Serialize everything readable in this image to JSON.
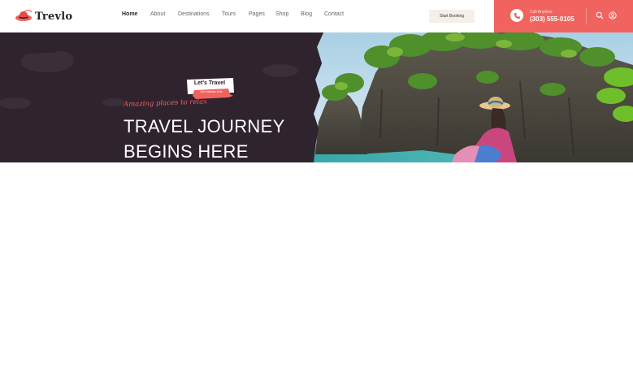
{
  "brand": {
    "name": "Trevlo",
    "accent": "#f1635f",
    "dark": "#2f232e"
  },
  "nav": {
    "items": [
      {
        "label": "Home",
        "active": true
      },
      {
        "label": "About",
        "active": false
      },
      {
        "label": "Destinations",
        "active": false
      },
      {
        "label": "Tours",
        "active": false
      },
      {
        "label": "Pages",
        "active": false
      },
      {
        "label": "Shop",
        "active": false
      },
      {
        "label": "Blog",
        "active": false
      },
      {
        "label": "Contact",
        "active": false
      }
    ]
  },
  "header": {
    "cta_label": "Start Booking",
    "call_label": "Call Anytime",
    "phone": "(303) 555-0105",
    "icons": [
      "phone-icon",
      "search-icon",
      "user-icon"
    ]
  },
  "hero": {
    "badge_title": "Let's Travel",
    "badge_sub": "Let's Wander Sofa",
    "tagline": "Amazing places to relax",
    "headline_line1": "TRAVEL JOURNEY",
    "headline_line2": "BEGINS HERE"
  }
}
